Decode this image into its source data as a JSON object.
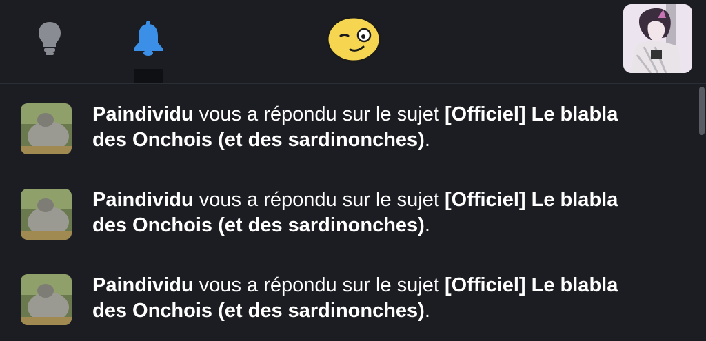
{
  "header": {
    "icons": {
      "ideas": "lightbulb-icon",
      "notifications": "bell-icon",
      "emoji": "smirk-emoji-icon",
      "profile": "user-avatar"
    },
    "colors": {
      "background": "#1c1d22",
      "bulb": "#8a8c93",
      "bell_active": "#3b8fe6",
      "emoji_yellow": "#f6d650"
    }
  },
  "notifications": [
    {
      "user": "Paindividu",
      "action": " vous a répondu sur le sujet ",
      "topic": "[Officiel] Le blabla des Onchois (et des sardinonches)",
      "suffix": "."
    },
    {
      "user": "Paindividu",
      "action": " vous a répondu sur le sujet ",
      "topic": "[Officiel] Le blabla des Onchois (et des sardinonches)",
      "suffix": "."
    },
    {
      "user": "Paindividu",
      "action": " vous a répondu sur le sujet ",
      "topic": "[Officiel] Le blabla des Onchois (et des sardinonches)",
      "suffix": "."
    }
  ]
}
